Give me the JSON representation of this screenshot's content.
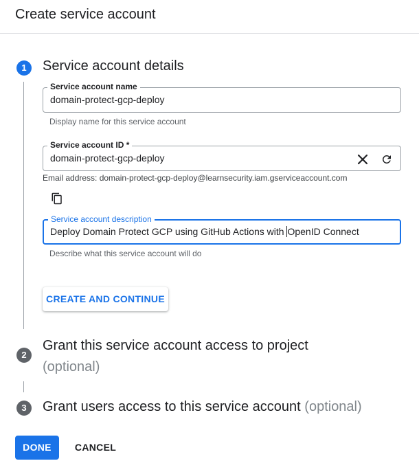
{
  "header": {
    "title": "Create service account"
  },
  "steps": [
    {
      "number": "1",
      "title": "Service account details",
      "optional": ""
    },
    {
      "number": "2",
      "title": "Grant this service account access to project",
      "optional": "(optional)"
    },
    {
      "number": "3",
      "title": "Grant users access to this service account",
      "optional": "(optional)"
    }
  ],
  "form": {
    "name": {
      "label": "Service account name",
      "value": "domain-protect-gcp-deploy",
      "helper": "Display name for this service account"
    },
    "id": {
      "label": "Service account ID *",
      "value": "domain-protect-gcp-deploy",
      "clear_icon": "close-icon",
      "refresh_icon": "refresh-icon"
    },
    "email": "Email address: domain-protect-gcp-deploy@learnsecurity.iam.gserviceaccount.com",
    "copy_icon": "copy-icon",
    "description": {
      "label": "Service account description",
      "value_before_caret": "Deploy Domain Protect GCP using GitHub Actions with ",
      "value_after_caret": "OpenID Connect",
      "helper": "Describe what this service account will do"
    }
  },
  "buttons": {
    "create": "CREATE AND CONTINUE",
    "done": "DONE",
    "cancel": "CANCEL"
  },
  "colors": {
    "accent": "#1a73e8",
    "inactive_step": "#5f6368",
    "divider": "#dadce0"
  }
}
